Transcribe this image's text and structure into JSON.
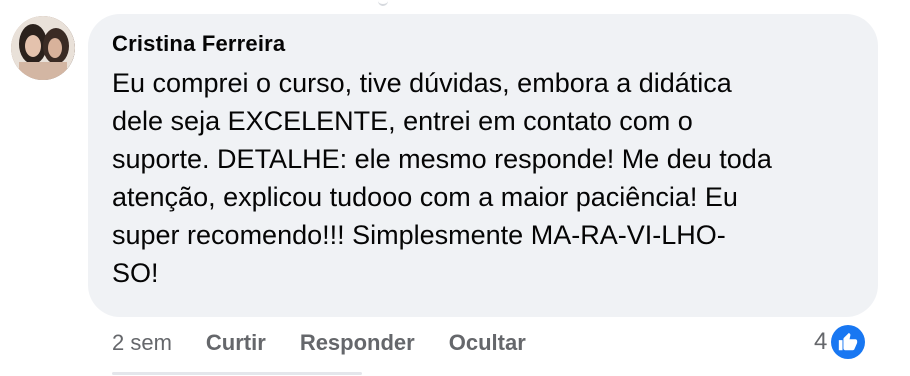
{
  "comment": {
    "author": "Cristina Ferreira",
    "text": "Eu comprei o curso, tive dúvidas, embora a didática\ndele seja EXCELENTE, entrei em contato com o\nsuporte. DETALHE: ele mesmo responde! Me deu toda\natenção, explicou tudooo com a maior paciência! Eu\nsuper recomendo!!! Simplesmente MA-RA-VI-LHO-\nSO!",
    "time": "2 sem",
    "actions": {
      "like": "Curtir",
      "reply": "Responder",
      "hide": "Ocultar"
    },
    "reactions": {
      "count": "4",
      "icon": "like-icon",
      "color": "#1877f2"
    }
  },
  "colors": {
    "bubble_bg": "#f0f2f5",
    "text_primary": "#050505",
    "text_secondary": "#65676b",
    "accent": "#1877f2"
  }
}
